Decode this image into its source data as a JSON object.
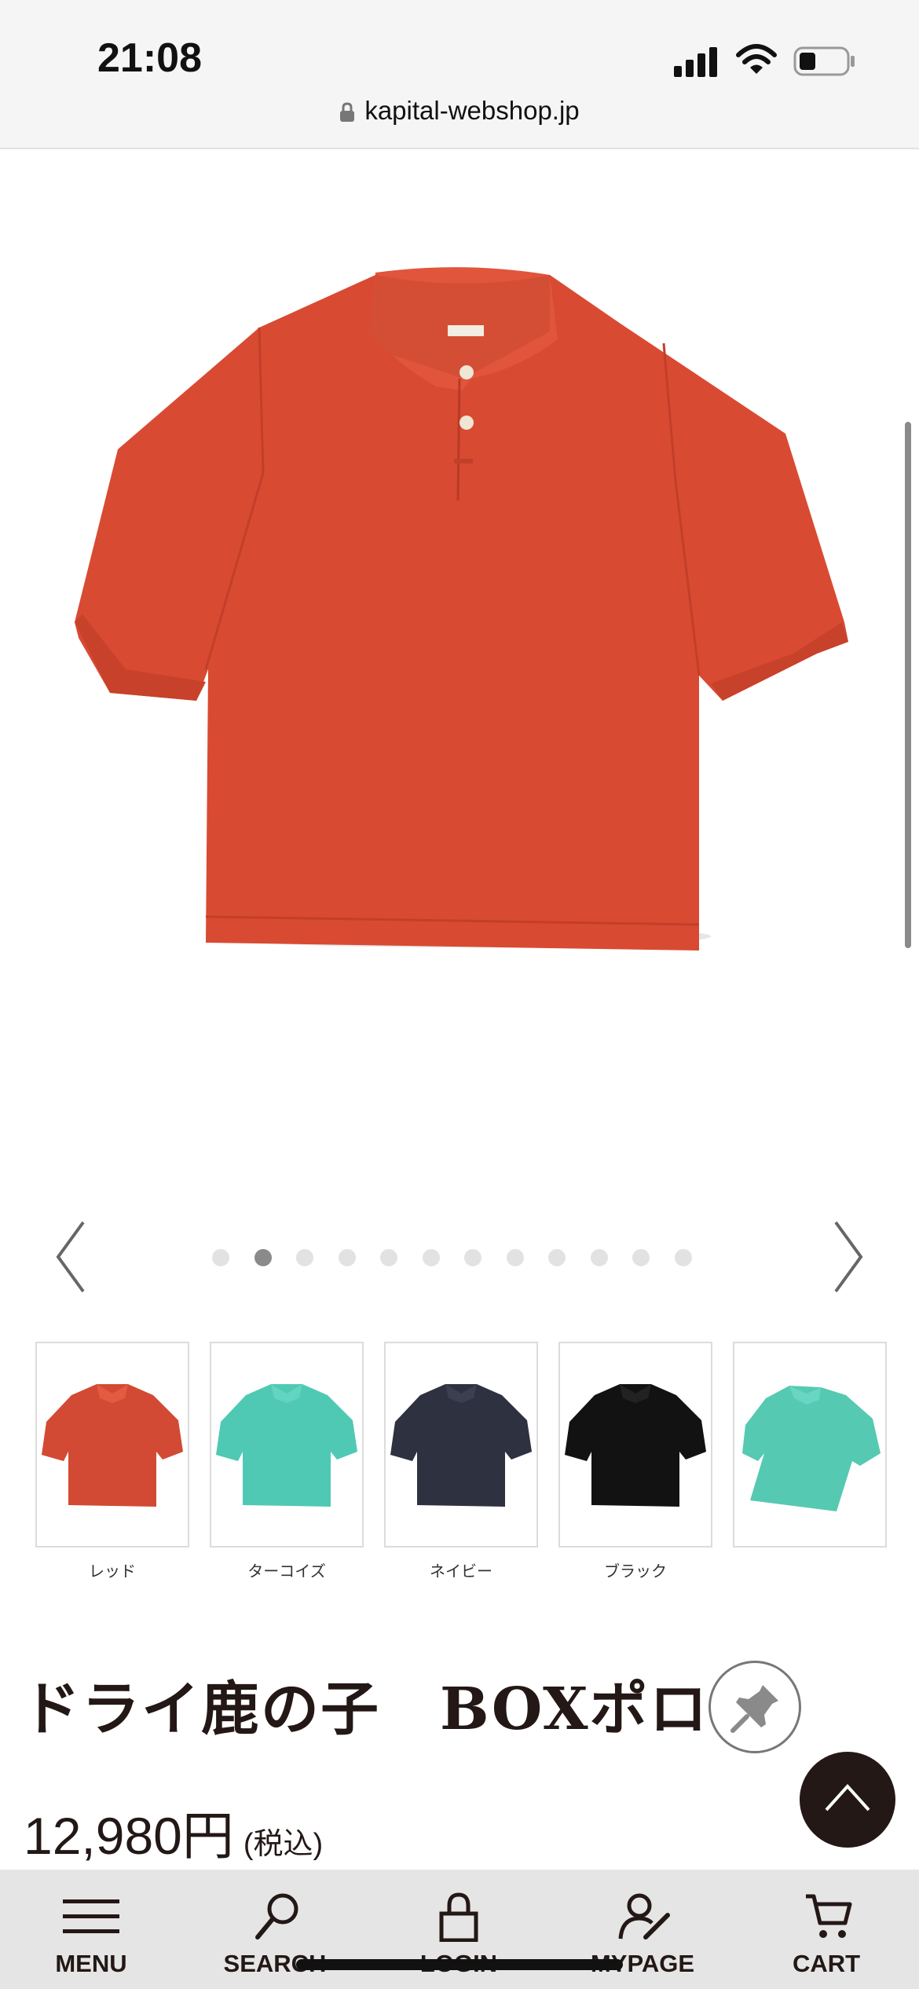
{
  "status_bar": {
    "time": "21:08",
    "url": "kapital-webshop.jp",
    "icons": [
      "signal-icon",
      "wifi-icon",
      "battery-icon",
      "lock-icon"
    ]
  },
  "product": {
    "main_image": "polo-shirt-red",
    "gallery": {
      "total_images": 12,
      "current_index": 2
    },
    "title": "ドライ鹿の子　BOXポロ",
    "price": "12,980円",
    "tax_note": "(税込)"
  },
  "colors": [
    {
      "label": "レッド",
      "swatch": "#d24a33"
    },
    {
      "label": "ターコイズ",
      "swatch": "#4fc9b4"
    },
    {
      "label": "ネイビー",
      "swatch": "#2e3140"
    },
    {
      "label": "ブラック",
      "swatch": "#121212"
    },
    {
      "label": "",
      "swatch": "#55c9b2"
    }
  ],
  "bottom_nav": {
    "menu": "MENU",
    "search": "SEARCH",
    "login": "LOGIN",
    "mypage": "MYPAGE",
    "cart": "CART"
  },
  "theme": {
    "brand_dark": "#231815",
    "shirt_red": "#d94a32"
  }
}
